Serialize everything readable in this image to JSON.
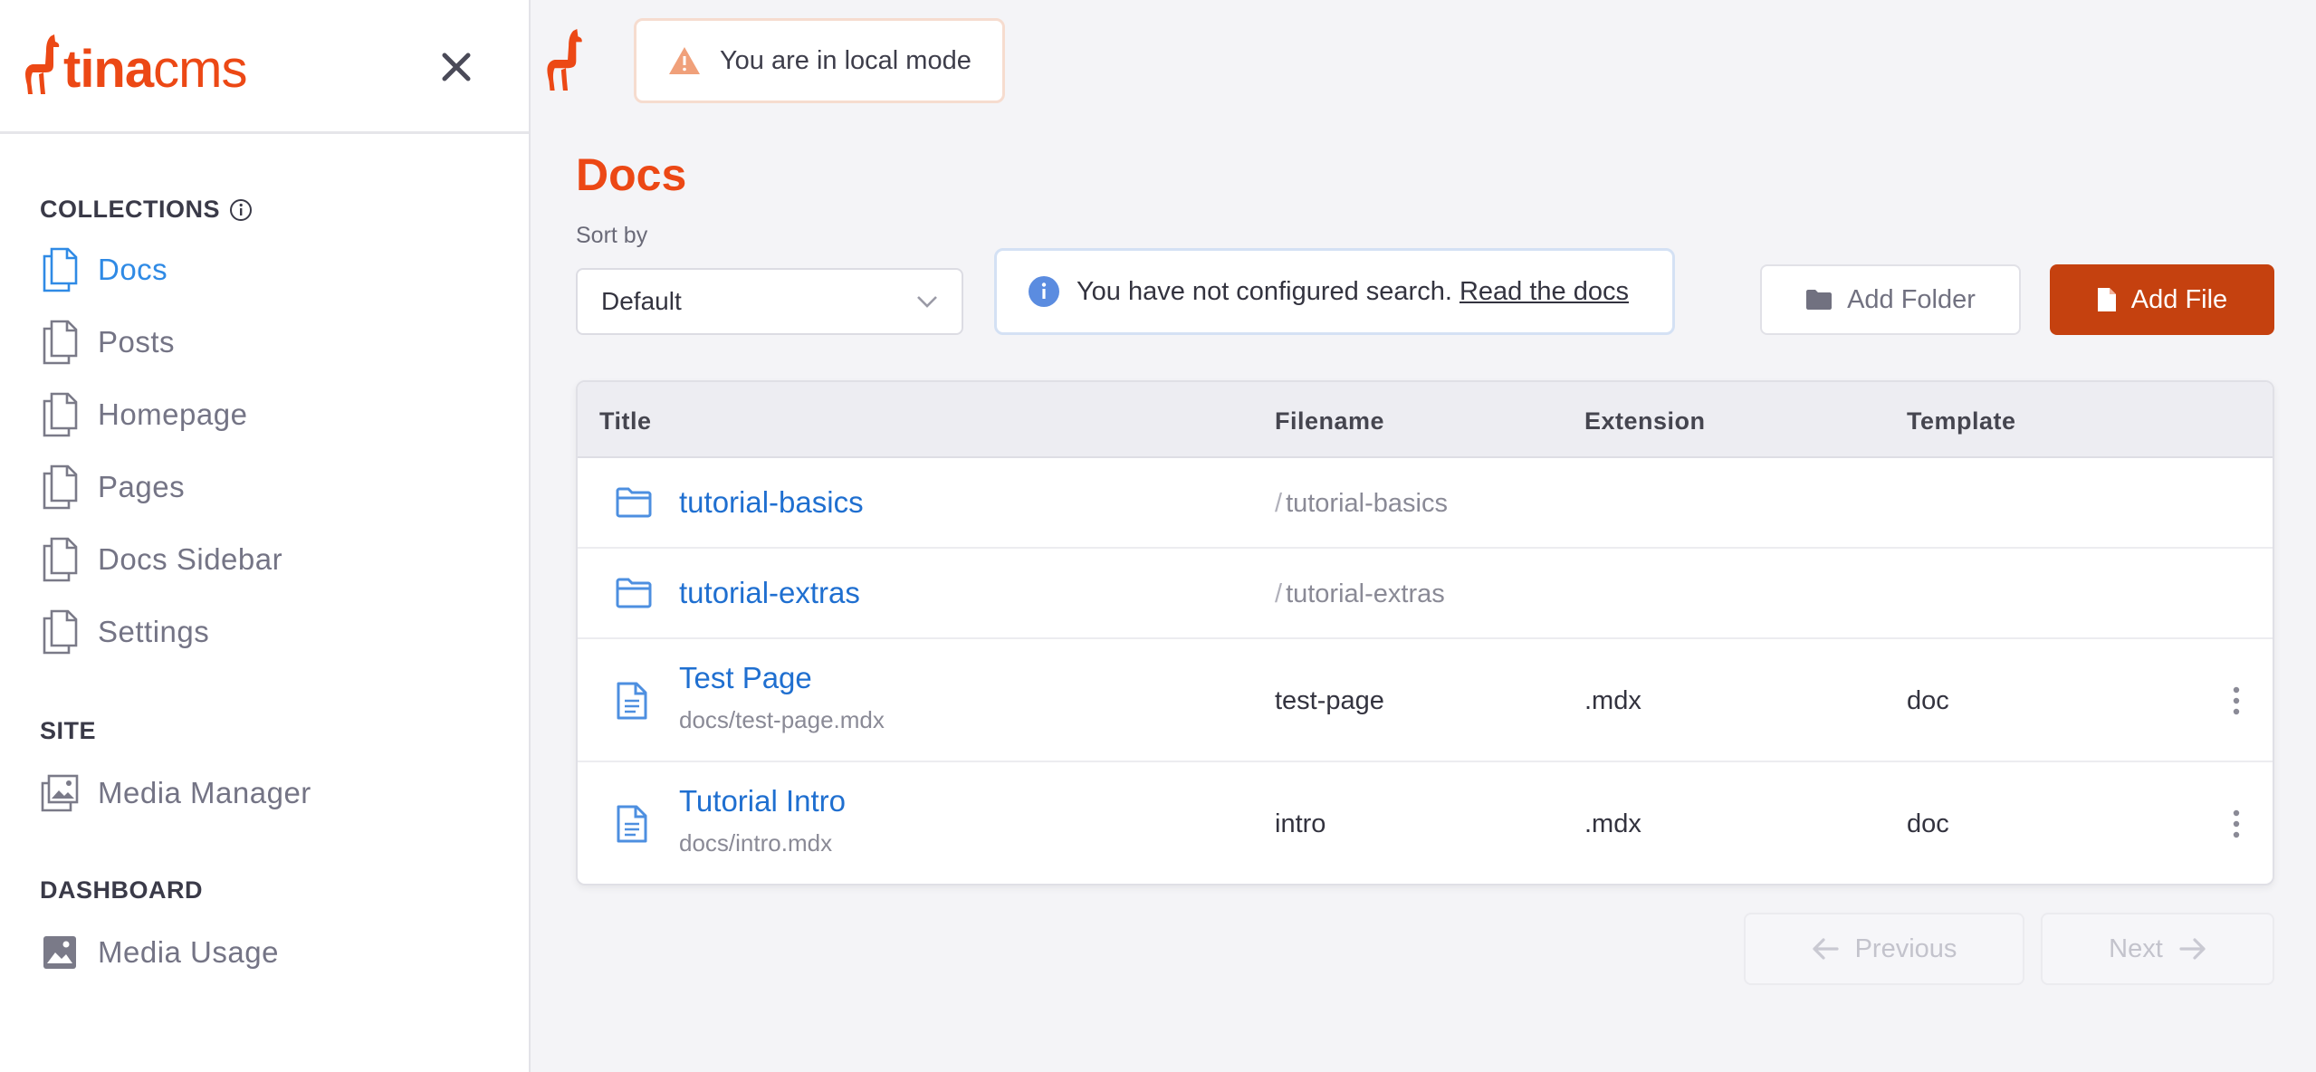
{
  "brand": {
    "name_bold": "tina",
    "name_light": "cms"
  },
  "colors": {
    "accent": "#ec4815",
    "link": "#1f6fd0",
    "active_nav": "#2f8ae5",
    "primary_button": "#c5410f"
  },
  "sidebar": {
    "collections_title": "COLLECTIONS",
    "collections": [
      {
        "label": "Docs",
        "active": true,
        "icon": "document-copy-icon"
      },
      {
        "label": "Posts",
        "icon": "document-copy-icon"
      },
      {
        "label": "Homepage",
        "icon": "document-copy-icon"
      },
      {
        "label": "Pages",
        "icon": "document-copy-icon"
      },
      {
        "label": "Docs Sidebar",
        "icon": "document-copy-icon"
      },
      {
        "label": "Settings",
        "icon": "document-copy-icon"
      }
    ],
    "site_title": "SITE",
    "site_items": [
      {
        "label": "Media Manager",
        "icon": "images-icon"
      }
    ],
    "dashboard_title": "DASHBOARD",
    "dashboard_items": [
      {
        "label": "Media Usage",
        "icon": "image-icon"
      }
    ]
  },
  "topbar": {
    "local_mode_text": "You are in local mode"
  },
  "main": {
    "title": "Docs",
    "sort_label": "Sort by",
    "sort_value": "Default",
    "search_notice": "You have not configured search.",
    "search_link": "Read the docs",
    "add_folder": "Add Folder",
    "add_file": "Add File"
  },
  "table": {
    "headers": {
      "title": "Title",
      "filename": "Filename",
      "extension": "Extension",
      "template": "Template"
    },
    "folders": [
      {
        "name": "tutorial-basics",
        "slash": "/",
        "path": "tutorial-basics"
      },
      {
        "name": "tutorial-extras",
        "slash": "/",
        "path": "tutorial-extras"
      }
    ],
    "files": [
      {
        "title": "Test Page",
        "path": "docs/test-page.mdx",
        "filename": "test-page",
        "extension": ".mdx",
        "template": "doc"
      },
      {
        "title": "Tutorial Intro",
        "path": "docs/intro.mdx",
        "filename": "intro",
        "extension": ".mdx",
        "template": "doc"
      }
    ]
  },
  "pagination": {
    "previous": "Previous",
    "next": "Next"
  }
}
